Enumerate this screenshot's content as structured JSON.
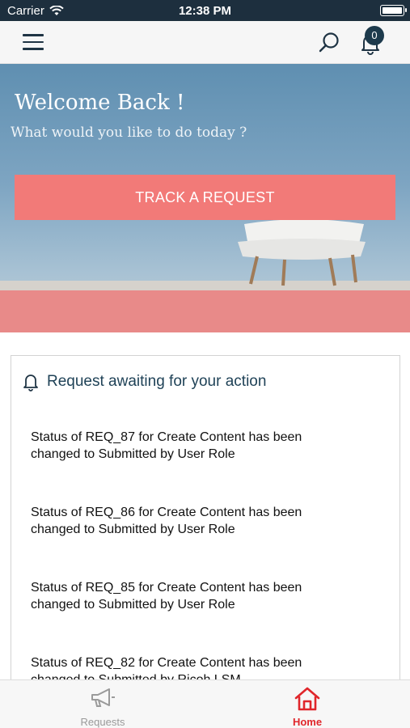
{
  "status_bar": {
    "carrier": "Carrier",
    "time": "12:38 PM"
  },
  "header": {
    "icons": [
      "menu-icon",
      "search-icon",
      "bell-icon"
    ],
    "notification_count": "0"
  },
  "hero": {
    "welcome": "Welcome Back !",
    "subtitle": "What would you like to do today ?",
    "track_button": "TRACK A REQUEST"
  },
  "awaiting_card": {
    "title": "Request awaiting for your action",
    "items": [
      {
        "line1": "Status of REQ_87 for Create Content has been",
        "line2": "changed to Submitted by User Role"
      },
      {
        "line1": "Status of REQ_86 for Create Content has been",
        "line2": "changed to Submitted by User Role"
      },
      {
        "line1": "Status of REQ_85 for Create Content has been",
        "line2": "changed to Submitted by User Role"
      },
      {
        "line1": "Status of REQ_82 for Create Content has been",
        "line2": "changed to Submitted by Ricoh LSM"
      }
    ]
  },
  "tabs": [
    {
      "label": "Requests",
      "icon": "megaphone-icon",
      "active": false
    },
    {
      "label": "Home",
      "icon": "home-icon",
      "active": true
    }
  ],
  "colors": {
    "status_bar": "#1d2f3e",
    "accent": "#f27a78",
    "active_tab": "#e0262b",
    "card_title": "#1f4257"
  }
}
